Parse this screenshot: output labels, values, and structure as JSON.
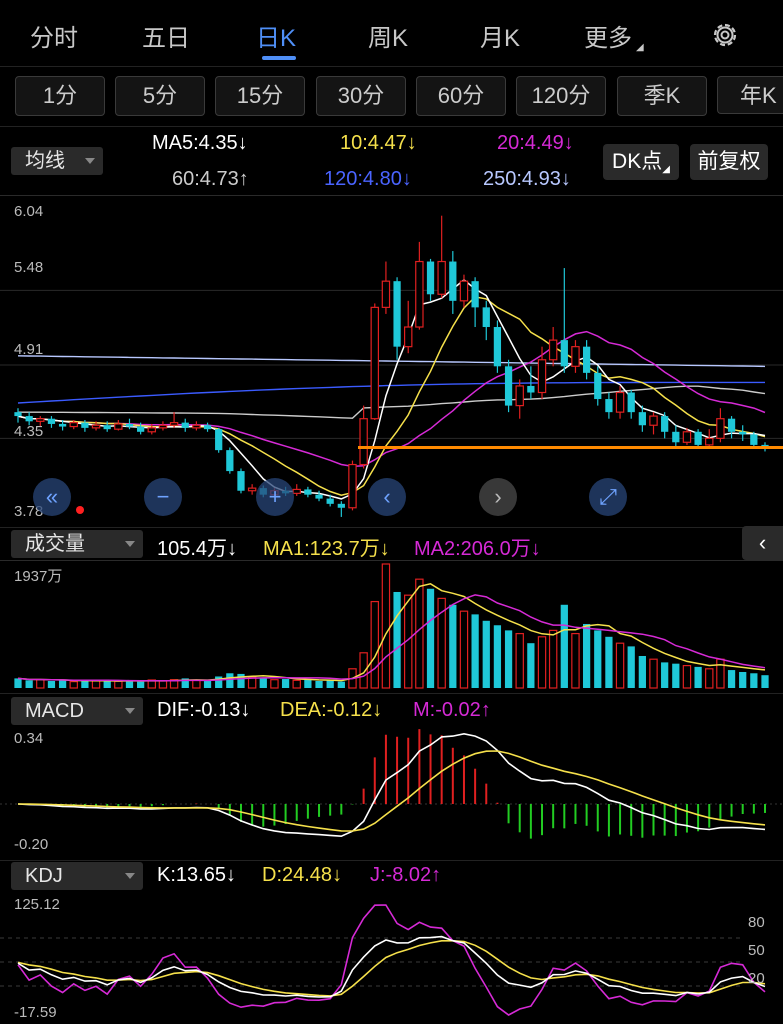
{
  "tabs": [
    {
      "label": "分时"
    },
    {
      "label": "五日"
    },
    {
      "label": "日K",
      "active": true
    },
    {
      "label": "周K"
    },
    {
      "label": "月K"
    },
    {
      "label": "更多"
    }
  ],
  "periods": [
    "1分",
    "5分",
    "15分",
    "30分",
    "60分",
    "120分",
    "季K",
    "年K"
  ],
  "ma_panel": {
    "selector": "均线",
    "ma5": "MA5:4.35",
    "ma10": "10:4.47",
    "ma20": "20:4.49",
    "ma60": "60:4.73",
    "ma120": "120:4.80",
    "ma250": "250:4.93",
    "dk_button": "DK点",
    "adjust_button": "前复权"
  },
  "price_axis": {
    "high": "6.04",
    "l1": "5.48",
    "l2": "4.91",
    "l3": "4.35",
    "low": "3.78"
  },
  "volume_panel": {
    "selector": "成交量",
    "value": "105.4万",
    "ma1": "MA1:123.7万",
    "ma2": "MA2:206.0万",
    "max": "1937万"
  },
  "macd_panel": {
    "selector": "MACD",
    "dif": "DIF:-0.13",
    "dea": "DEA:-0.12",
    "m": "M:-0.02",
    "max": "0.34",
    "min": "-0.20"
  },
  "kdj_panel": {
    "selector": "KDJ",
    "k": "K:13.65",
    "d": "D:24.48",
    "j": "J:-8.02",
    "max": "125.12",
    "min": "-17.59",
    "r80": "80",
    "r50": "50",
    "r20": "20"
  },
  "arrows": {
    "down": "↓",
    "up": "↑"
  },
  "controls": {
    "fast_back": "«",
    "zoom_out": "−",
    "zoom_in": "+",
    "prev": "‹",
    "next": "›",
    "fullscreen": "⤢",
    "collapse": "‹"
  },
  "colors": {
    "up": "#e02020",
    "down": "#1fc8d8",
    "ma5": "#ffffff",
    "ma10": "#f5e04b",
    "ma20": "#d62ad6",
    "ma60": "#cccccc",
    "ma120": "#3b5bff",
    "ma250": "#b8c8ff",
    "support": "#ff8a00",
    "accent": "#4f8ff7"
  },
  "chart_data": {
    "type": "candlestick",
    "price_range": [
      3.78,
      6.04
    ],
    "candles": [
      [
        4.55,
        4.52,
        4.58,
        4.47
      ],
      [
        4.52,
        4.48,
        4.55,
        4.45
      ],
      [
        4.48,
        4.5,
        4.52,
        4.44
      ],
      [
        4.5,
        4.46,
        4.52,
        4.43
      ],
      [
        4.46,
        4.44,
        4.49,
        4.41
      ],
      [
        4.44,
        4.47,
        4.49,
        4.42
      ],
      [
        4.47,
        4.43,
        4.49,
        4.4
      ],
      [
        4.43,
        4.45,
        4.48,
        4.41
      ],
      [
        4.45,
        4.42,
        4.48,
        4.4
      ],
      [
        4.42,
        4.46,
        4.49,
        4.41
      ],
      [
        4.46,
        4.44,
        4.5,
        4.42
      ],
      [
        4.44,
        4.4,
        4.47,
        4.38
      ],
      [
        4.4,
        4.43,
        4.46,
        4.38
      ],
      [
        4.43,
        4.45,
        4.48,
        4.41
      ],
      [
        4.45,
        4.47,
        4.55,
        4.43
      ],
      [
        4.47,
        4.43,
        4.5,
        4.4
      ],
      [
        4.43,
        4.45,
        4.48,
        4.41
      ],
      [
        4.45,
        4.42,
        4.47,
        4.4
      ],
      [
        4.42,
        4.26,
        4.43,
        4.24
      ],
      [
        4.26,
        4.1,
        4.28,
        4.08
      ],
      [
        4.1,
        3.95,
        4.12,
        3.93
      ],
      [
        3.95,
        3.97,
        4.0,
        3.92
      ],
      [
        3.97,
        3.92,
        3.99,
        3.9
      ],
      [
        3.92,
        3.95,
        3.97,
        3.9
      ],
      [
        3.95,
        3.93,
        3.98,
        3.91
      ],
      [
        3.93,
        3.96,
        4.0,
        3.91
      ],
      [
        3.96,
        3.92,
        3.98,
        3.9
      ],
      [
        3.92,
        3.89,
        3.95,
        3.87
      ],
      [
        3.89,
        3.85,
        3.92,
        3.83
      ],
      [
        3.85,
        3.82,
        3.87,
        3.75
      ],
      [
        3.82,
        4.15,
        4.18,
        3.8
      ],
      [
        4.15,
        4.5,
        4.6,
        4.12
      ],
      [
        4.5,
        5.35,
        5.38,
        4.49
      ],
      [
        5.35,
        5.55,
        5.7,
        5.3
      ],
      [
        5.55,
        5.05,
        5.58,
        4.95
      ],
      [
        5.05,
        5.2,
        5.4,
        5.0
      ],
      [
        5.2,
        5.7,
        5.85,
        5.18
      ],
      [
        5.7,
        5.45,
        5.72,
        5.4
      ],
      [
        5.45,
        5.7,
        6.05,
        5.42
      ],
      [
        5.7,
        5.4,
        5.78,
        5.3
      ],
      [
        5.4,
        5.55,
        5.6,
        5.35
      ],
      [
        5.55,
        5.35,
        5.58,
        5.2
      ],
      [
        5.35,
        5.2,
        5.4,
        5.1
      ],
      [
        5.2,
        4.9,
        5.25,
        4.85
      ],
      [
        4.9,
        4.6,
        4.95,
        4.55
      ],
      [
        4.6,
        4.75,
        4.8,
        4.5
      ],
      [
        4.75,
        4.7,
        4.9,
        4.65
      ],
      [
        4.7,
        4.95,
        5.05,
        4.65
      ],
      [
        4.95,
        5.1,
        5.2,
        4.9
      ],
      [
        5.1,
        4.9,
        5.65,
        4.85
      ],
      [
        4.9,
        5.05,
        5.1,
        4.85
      ],
      [
        5.05,
        4.85,
        5.1,
        4.8
      ],
      [
        4.85,
        4.65,
        4.9,
        4.6
      ],
      [
        4.65,
        4.55,
        4.7,
        4.5
      ],
      [
        4.55,
        4.7,
        4.75,
        4.5
      ],
      [
        4.7,
        4.55,
        4.72,
        4.5
      ],
      [
        4.55,
        4.45,
        4.6,
        4.4
      ],
      [
        4.45,
        4.52,
        4.55,
        4.38
      ],
      [
        4.52,
        4.4,
        4.55,
        4.35
      ],
      [
        4.4,
        4.32,
        4.45,
        4.28
      ],
      [
        4.32,
        4.4,
        4.43,
        4.3
      ],
      [
        4.4,
        4.3,
        4.42,
        4.27
      ],
      [
        4.3,
        4.35,
        4.42,
        4.28
      ],
      [
        4.35,
        4.5,
        4.58,
        4.32
      ],
      [
        4.5,
        4.4,
        4.52,
        4.35
      ],
      [
        4.4,
        4.38,
        4.45,
        4.33
      ],
      [
        4.38,
        4.3,
        4.4,
        4.27
      ],
      [
        4.3,
        4.28,
        4.32,
        4.25
      ]
    ],
    "volume_range": [
      0,
      1937
    ],
    "volume": [
      150,
      120,
      130,
      110,
      125,
      100,
      115,
      110,
      120,
      105,
      115,
      100,
      125,
      110,
      130,
      150,
      120,
      110,
      180,
      230,
      220,
      170,
      150,
      130,
      140,
      120,
      130,
      110,
      120,
      100,
      300,
      550,
      1350,
      1937,
      1500,
      1450,
      1700,
      1550,
      1400,
      1300,
      1200,
      1150,
      1050,
      980,
      900,
      850,
      700,
      800,
      900,
      1300,
      850,
      1000,
      900,
      800,
      700,
      650,
      500,
      450,
      400,
      380,
      350,
      330,
      300,
      450,
      280,
      250,
      230,
      200
    ],
    "macd_range": [
      -0.2,
      0.34
    ],
    "kdj_range": [
      -17.59,
      125.12
    ]
  }
}
